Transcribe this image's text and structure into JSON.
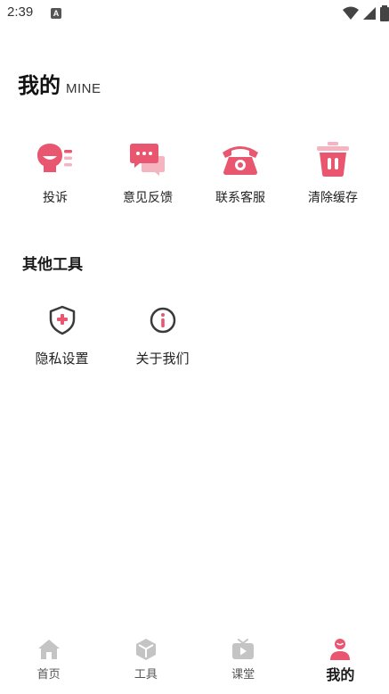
{
  "status": {
    "time": "2:39",
    "notification_icon_letter": "A"
  },
  "header": {
    "title": "我的",
    "subtitle": "MINE"
  },
  "actions": [
    {
      "label": "投诉",
      "icon": "complaint-icon"
    },
    {
      "label": "意见反馈",
      "icon": "feedback-icon"
    },
    {
      "label": "联系客服",
      "icon": "phone-icon"
    },
    {
      "label": "清除缓存",
      "icon": "trash-icon"
    }
  ],
  "other_tools": {
    "title": "其他工具",
    "items": [
      {
        "label": "隐私设置",
        "icon": "shield-plus-icon"
      },
      {
        "label": "关于我们",
        "icon": "info-icon"
      }
    ]
  },
  "tabs": [
    {
      "label": "首页",
      "icon": "home-icon",
      "active": false
    },
    {
      "label": "工具",
      "icon": "cube-icon",
      "active": false
    },
    {
      "label": "课堂",
      "icon": "tv-play-icon",
      "active": false
    },
    {
      "label": "我的",
      "icon": "person-icon",
      "active": true
    }
  ],
  "colors": {
    "accent": "#e8566f",
    "accent_light": "#f6b3c0",
    "icon_dark": "#3a3a3a",
    "tab_inactive": "#c4c4c4"
  }
}
